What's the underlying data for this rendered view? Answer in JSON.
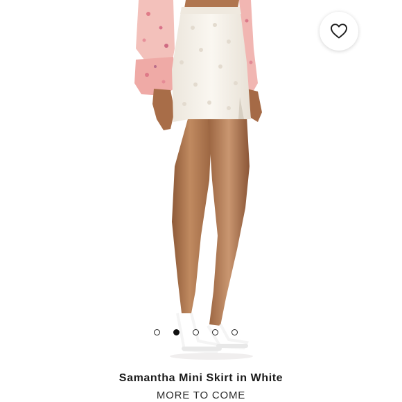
{
  "product": {
    "name": "Samantha Mini Skirt in White",
    "status": "MORE TO COME"
  },
  "carousel": {
    "count": 5,
    "active_index": 1
  },
  "favorite": {
    "icon": "heart-outline-icon"
  },
  "colors": {
    "skirt": "#f7f3ec",
    "skin": "#b27a52",
    "blouse": "#f2b8b4",
    "dot_active": "#111111"
  }
}
